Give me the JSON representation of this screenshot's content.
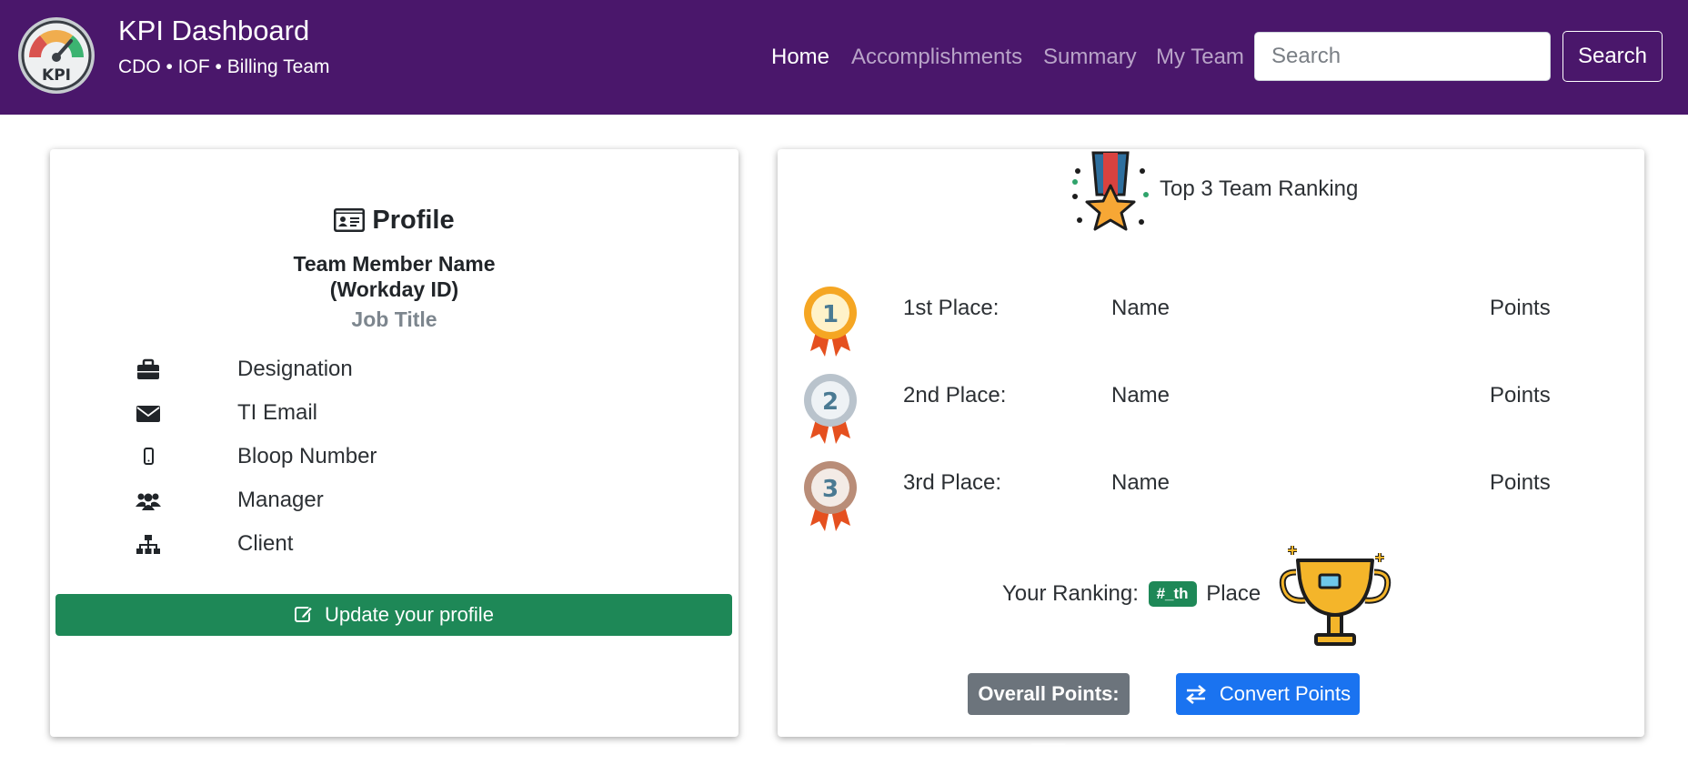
{
  "navbar": {
    "logo_text": "KPI",
    "title": "KPI Dashboard",
    "subtitle": "CDO • IOF • Billing Team",
    "links": [
      {
        "label": "Home",
        "active": true
      },
      {
        "label": "Accomplishments",
        "active": false
      },
      {
        "label": "Summary",
        "active": false
      },
      {
        "label": "My Team",
        "active": false
      }
    ],
    "search_placeholder": "Search",
    "search_button": "Search"
  },
  "profile": {
    "heading": "Profile",
    "member_name_line1": "Team Member Name",
    "member_name_line2": "(Workday ID)",
    "job_title": "Job Title",
    "details": [
      {
        "icon": "briefcase-icon",
        "label": "Designation"
      },
      {
        "icon": "envelope-icon",
        "label": "TI Email"
      },
      {
        "icon": "mobile-phone-icon",
        "label": "Bloop Number"
      },
      {
        "icon": "users-icon",
        "label": "Manager"
      },
      {
        "icon": "sitemap-icon",
        "label": "Client"
      }
    ],
    "update_button": "Update your profile"
  },
  "ranking": {
    "title": "Top 3 Team Ranking",
    "places": [
      {
        "label": "1st Place:",
        "name": "Name",
        "points": "Points",
        "medal_number": "1",
        "medal_color": "#f5a623"
      },
      {
        "label": "2nd Place:",
        "name": "Name",
        "points": "Points",
        "medal_number": "2",
        "medal_color": "#b9c3cc"
      },
      {
        "label": "3rd Place:",
        "name": "Name",
        "points": "Points",
        "medal_number": "3",
        "medal_color": "#b98d78"
      }
    ],
    "your_ranking_label": "Your Ranking:",
    "your_ranking_badge": "#_th",
    "your_ranking_suffix": "Place",
    "overall_points": "Overall Points: ___",
    "convert_button": "Convert Points"
  },
  "colors": {
    "navbar_bg": "#4a176b",
    "success_green": "#1e8857",
    "primary_blue": "#1a73f0",
    "secondary_gray": "#6c747c"
  }
}
